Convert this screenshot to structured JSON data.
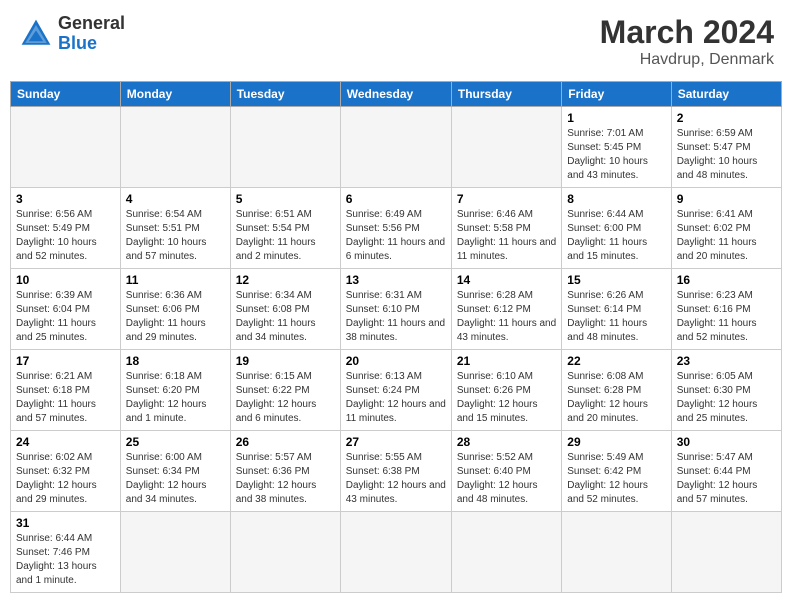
{
  "header": {
    "logo_general": "General",
    "logo_blue": "Blue",
    "main_title": "March 2024",
    "sub_title": "Havdrup, Denmark"
  },
  "columns": [
    "Sunday",
    "Monday",
    "Tuesday",
    "Wednesday",
    "Thursday",
    "Friday",
    "Saturday"
  ],
  "weeks": [
    [
      {
        "day": "",
        "info": ""
      },
      {
        "day": "",
        "info": ""
      },
      {
        "day": "",
        "info": ""
      },
      {
        "day": "",
        "info": ""
      },
      {
        "day": "",
        "info": ""
      },
      {
        "day": "1",
        "info": "Sunrise: 7:01 AM\nSunset: 5:45 PM\nDaylight: 10 hours and 43 minutes."
      },
      {
        "day": "2",
        "info": "Sunrise: 6:59 AM\nSunset: 5:47 PM\nDaylight: 10 hours and 48 minutes."
      }
    ],
    [
      {
        "day": "3",
        "info": "Sunrise: 6:56 AM\nSunset: 5:49 PM\nDaylight: 10 hours and 52 minutes."
      },
      {
        "day": "4",
        "info": "Sunrise: 6:54 AM\nSunset: 5:51 PM\nDaylight: 10 hours and 57 minutes."
      },
      {
        "day": "5",
        "info": "Sunrise: 6:51 AM\nSunset: 5:54 PM\nDaylight: 11 hours and 2 minutes."
      },
      {
        "day": "6",
        "info": "Sunrise: 6:49 AM\nSunset: 5:56 PM\nDaylight: 11 hours and 6 minutes."
      },
      {
        "day": "7",
        "info": "Sunrise: 6:46 AM\nSunset: 5:58 PM\nDaylight: 11 hours and 11 minutes."
      },
      {
        "day": "8",
        "info": "Sunrise: 6:44 AM\nSunset: 6:00 PM\nDaylight: 11 hours and 15 minutes."
      },
      {
        "day": "9",
        "info": "Sunrise: 6:41 AM\nSunset: 6:02 PM\nDaylight: 11 hours and 20 minutes."
      }
    ],
    [
      {
        "day": "10",
        "info": "Sunrise: 6:39 AM\nSunset: 6:04 PM\nDaylight: 11 hours and 25 minutes."
      },
      {
        "day": "11",
        "info": "Sunrise: 6:36 AM\nSunset: 6:06 PM\nDaylight: 11 hours and 29 minutes."
      },
      {
        "day": "12",
        "info": "Sunrise: 6:34 AM\nSunset: 6:08 PM\nDaylight: 11 hours and 34 minutes."
      },
      {
        "day": "13",
        "info": "Sunrise: 6:31 AM\nSunset: 6:10 PM\nDaylight: 11 hours and 38 minutes."
      },
      {
        "day": "14",
        "info": "Sunrise: 6:28 AM\nSunset: 6:12 PM\nDaylight: 11 hours and 43 minutes."
      },
      {
        "day": "15",
        "info": "Sunrise: 6:26 AM\nSunset: 6:14 PM\nDaylight: 11 hours and 48 minutes."
      },
      {
        "day": "16",
        "info": "Sunrise: 6:23 AM\nSunset: 6:16 PM\nDaylight: 11 hours and 52 minutes."
      }
    ],
    [
      {
        "day": "17",
        "info": "Sunrise: 6:21 AM\nSunset: 6:18 PM\nDaylight: 11 hours and 57 minutes."
      },
      {
        "day": "18",
        "info": "Sunrise: 6:18 AM\nSunset: 6:20 PM\nDaylight: 12 hours and 1 minute."
      },
      {
        "day": "19",
        "info": "Sunrise: 6:15 AM\nSunset: 6:22 PM\nDaylight: 12 hours and 6 minutes."
      },
      {
        "day": "20",
        "info": "Sunrise: 6:13 AM\nSunset: 6:24 PM\nDaylight: 12 hours and 11 minutes."
      },
      {
        "day": "21",
        "info": "Sunrise: 6:10 AM\nSunset: 6:26 PM\nDaylight: 12 hours and 15 minutes."
      },
      {
        "day": "22",
        "info": "Sunrise: 6:08 AM\nSunset: 6:28 PM\nDaylight: 12 hours and 20 minutes."
      },
      {
        "day": "23",
        "info": "Sunrise: 6:05 AM\nSunset: 6:30 PM\nDaylight: 12 hours and 25 minutes."
      }
    ],
    [
      {
        "day": "24",
        "info": "Sunrise: 6:02 AM\nSunset: 6:32 PM\nDaylight: 12 hours and 29 minutes."
      },
      {
        "day": "25",
        "info": "Sunrise: 6:00 AM\nSunset: 6:34 PM\nDaylight: 12 hours and 34 minutes."
      },
      {
        "day": "26",
        "info": "Sunrise: 5:57 AM\nSunset: 6:36 PM\nDaylight: 12 hours and 38 minutes."
      },
      {
        "day": "27",
        "info": "Sunrise: 5:55 AM\nSunset: 6:38 PM\nDaylight: 12 hours and 43 minutes."
      },
      {
        "day": "28",
        "info": "Sunrise: 5:52 AM\nSunset: 6:40 PM\nDaylight: 12 hours and 48 minutes."
      },
      {
        "day": "29",
        "info": "Sunrise: 5:49 AM\nSunset: 6:42 PM\nDaylight: 12 hours and 52 minutes."
      },
      {
        "day": "30",
        "info": "Sunrise: 5:47 AM\nSunset: 6:44 PM\nDaylight: 12 hours and 57 minutes."
      }
    ],
    [
      {
        "day": "31",
        "info": "Sunrise: 6:44 AM\nSunset: 7:46 PM\nDaylight: 13 hours and 1 minute."
      },
      {
        "day": "",
        "info": ""
      },
      {
        "day": "",
        "info": ""
      },
      {
        "day": "",
        "info": ""
      },
      {
        "day": "",
        "info": ""
      },
      {
        "day": "",
        "info": ""
      },
      {
        "day": "",
        "info": ""
      }
    ]
  ]
}
